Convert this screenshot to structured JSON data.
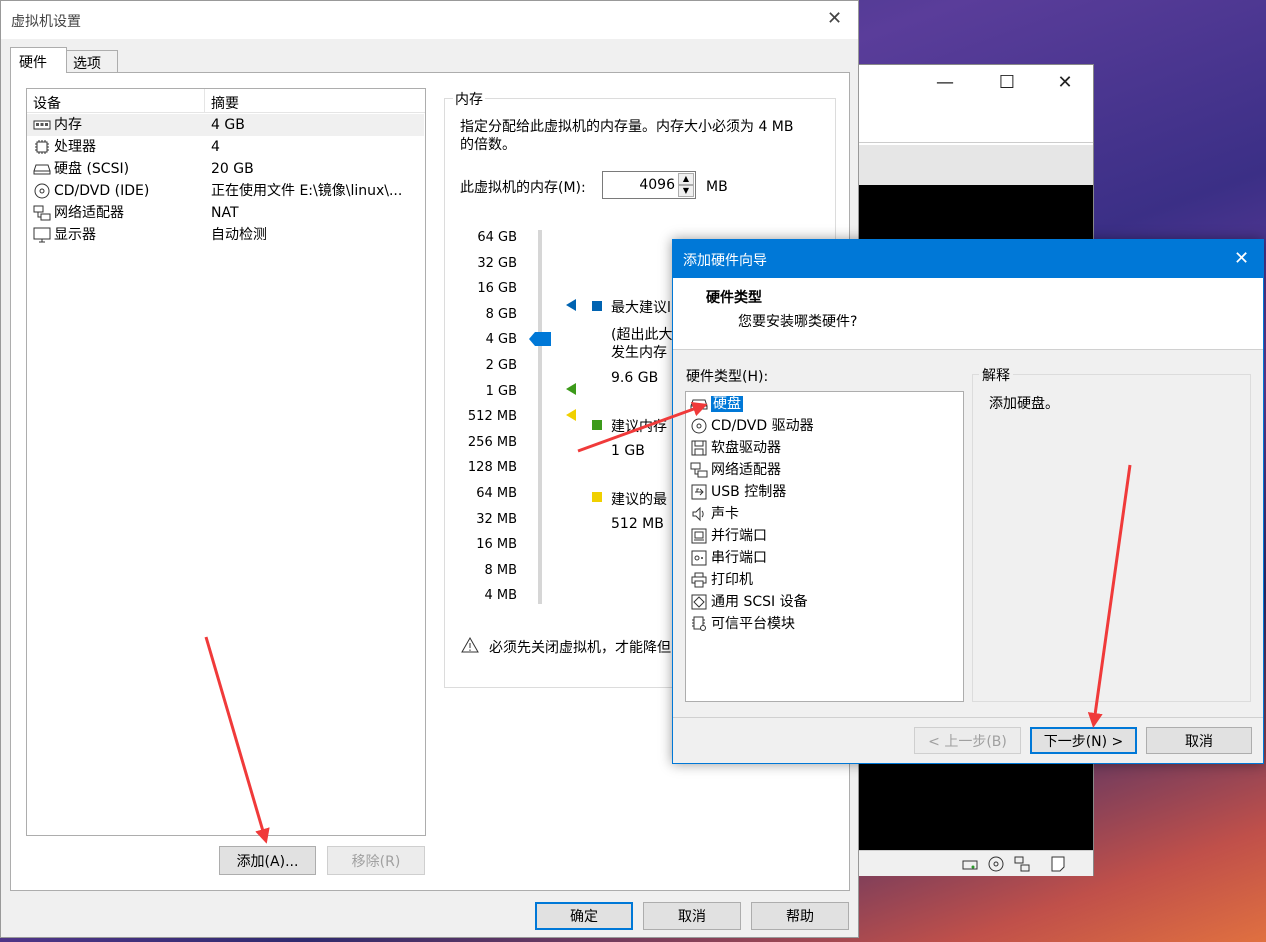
{
  "bg_window": {
    "minimize": "—",
    "maximize": "☐",
    "close": "✕"
  },
  "settings": {
    "title": "虚拟机设置",
    "close": "✕",
    "tabs": [
      "硬件",
      "选项"
    ],
    "col_device": "设备",
    "col_summary": "摘要",
    "devices": [
      {
        "name": "内存",
        "summary": "4 GB",
        "icon": "memory-icon"
      },
      {
        "name": "处理器",
        "summary": "4",
        "icon": "cpu-icon"
      },
      {
        "name": "硬盘 (SCSI)",
        "summary": "20 GB",
        "icon": "hard-disk-icon"
      },
      {
        "name": "CD/DVD (IDE)",
        "summary": "正在使用文件 E:\\镜像\\linux\\...",
        "icon": "cd-dvd-icon"
      },
      {
        "name": "网络适配器",
        "summary": "NAT",
        "icon": "network-icon"
      },
      {
        "name": "显示器",
        "summary": "自动检测",
        "icon": "monitor-icon"
      }
    ],
    "add_button": "添加(A)...",
    "remove_button": "移除(R)",
    "ok": "确定",
    "cancel": "取消",
    "help": "帮助",
    "memory": {
      "group_title": "内存",
      "desc_line1": "指定分配给此虚拟机的内存量。内存大小必须为 4 MB",
      "desc_line2": "的倍数。",
      "label": "此虚拟机的内存(M):",
      "value": "4096",
      "unit": "MB",
      "ticks": [
        "64 GB",
        "32 GB",
        "16 GB",
        "8 GB",
        "4 GB",
        "2 GB",
        "1 GB",
        "512 MB",
        "256 MB",
        "128 MB",
        "64 MB",
        "32 MB",
        "16 MB",
        "8 MB",
        "4 MB"
      ],
      "max_rec_label": "最大建议l",
      "max_rec_note1": "(超出此大",
      "max_rec_note2": "发生内存",
      "max_rec_value": "9.6 GB",
      "rec_label": "建议内存",
      "rec_value": "1 GB",
      "min_rec_label": "建议的最",
      "min_rec_value": "512 MB",
      "warning": "必须先关闭虚拟机，才能降但",
      "colors": {
        "max": "#0063b1",
        "rec": "#3c9a1a",
        "min": "#f0d000"
      }
    }
  },
  "wizard": {
    "title": "添加硬件向导",
    "close": "✕",
    "heading": "硬件类型",
    "subheading": "您要安装哪类硬件?",
    "list_label": "硬件类型(H):",
    "items": [
      {
        "label": "硬盘",
        "icon": "hard-disk-icon"
      },
      {
        "label": "CD/DVD 驱动器",
        "icon": "cd-dvd-icon"
      },
      {
        "label": "软盘驱动器",
        "icon": "floppy-icon"
      },
      {
        "label": "网络适配器",
        "icon": "network-icon"
      },
      {
        "label": "USB 控制器",
        "icon": "usb-icon"
      },
      {
        "label": "声卡",
        "icon": "speaker-icon"
      },
      {
        "label": "并行端口",
        "icon": "parallel-port-icon"
      },
      {
        "label": "串行端口",
        "icon": "serial-port-icon"
      },
      {
        "label": "打印机",
        "icon": "printer-icon"
      },
      {
        "label": "通用 SCSI 设备",
        "icon": "scsi-icon"
      },
      {
        "label": "可信平台模块",
        "icon": "tpm-icon"
      }
    ],
    "explain_title": "解释",
    "explain_text": "添加硬盘。",
    "back": "< 上一步(B)",
    "next": "下一步(N) >",
    "cancel": "取消"
  }
}
